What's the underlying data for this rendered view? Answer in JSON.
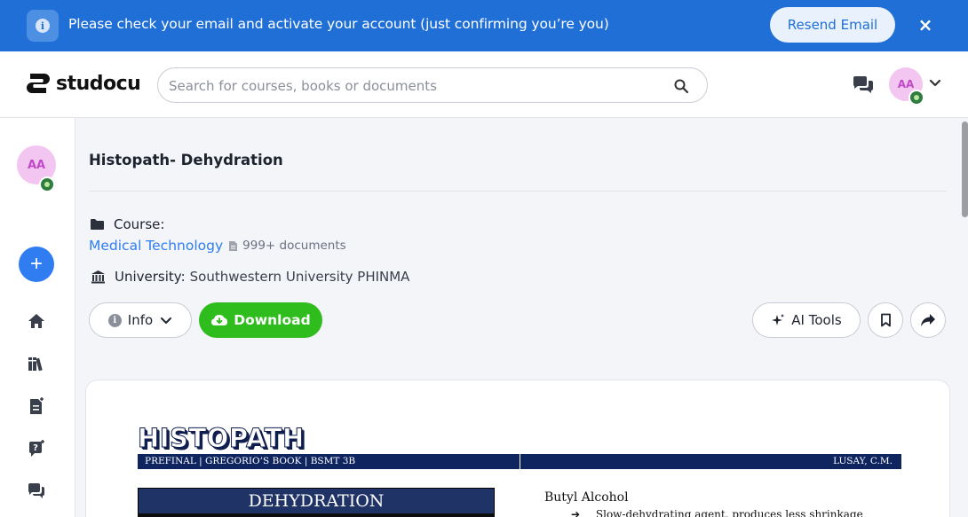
{
  "banner": {
    "message": "Please check your email and activate your account (just confirming you’re you)",
    "resend_label": "Resend Email",
    "close_symbol": "×",
    "info_symbol": "i"
  },
  "header": {
    "logo_text": "studocu",
    "search_placeholder": "Search for courses, books or documents",
    "avatar_initials": "AA"
  },
  "rail": {
    "avatar_initials": "AA",
    "add_symbol": "+",
    "items": [
      {
        "icon": "home-icon"
      },
      {
        "icon": "library-icon"
      },
      {
        "icon": "new-document-icon"
      },
      {
        "icon": "ask-question-icon"
      },
      {
        "icon": "chat-icon"
      }
    ]
  },
  "document": {
    "title": "Histopath- Dehydration",
    "course_label": "Course:",
    "course_name": "Medical Technology",
    "doc_count": "999+ documents",
    "university_label": "University:",
    "university_name": "Southwestern University PHINMA"
  },
  "actions": {
    "info_label": "Info",
    "download_label": "Download",
    "ai_tools_label": "AI Tools"
  },
  "preview": {
    "heading": "HISTOPATH",
    "bar_left": "PREFINAL | GREGORIO’S BOOK | BSMT 3B",
    "bar_right": "LUSAY, C.M.",
    "section_title": "DEHYDRATION",
    "col_heading": "Butyl Alcohol",
    "bullet_arrow": "➔",
    "bullet_text": "Slow-dehydrating agent, produces less shrinkage"
  },
  "colors": {
    "banner": "#1f6fd6",
    "accent_blue": "#2f7df0",
    "download_green": "#2ebd1c",
    "avatar_bg": "#f2c6f0"
  }
}
